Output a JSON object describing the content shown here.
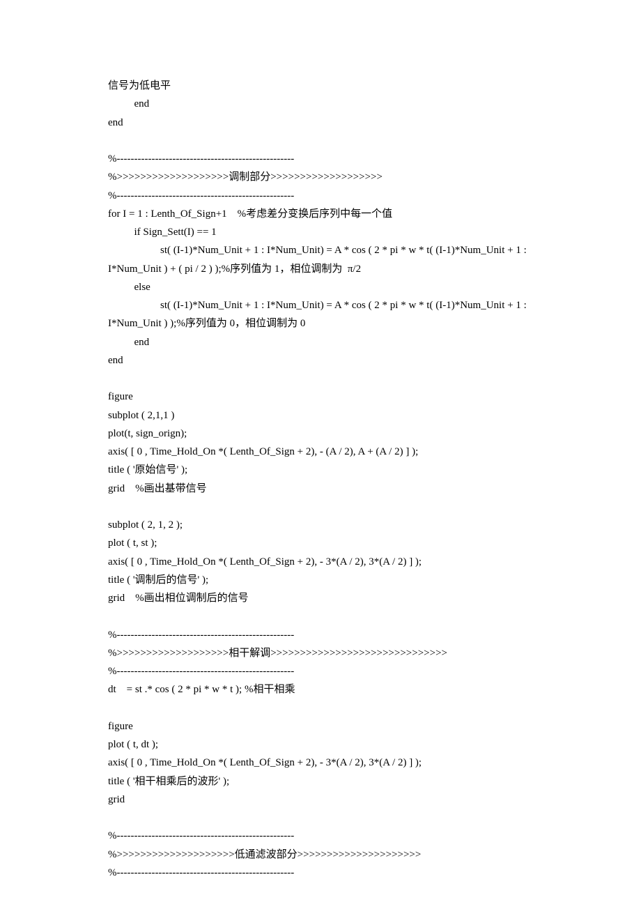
{
  "lines": [
    {
      "t": "信号为低电平",
      "indent": 0
    },
    {
      "t": "end",
      "indent": 1
    },
    {
      "t": "end",
      "indent": 0
    },
    {
      "t": "",
      "indent": 0,
      "blank": true
    },
    {
      "t": "%---------------------------------------------------",
      "indent": 0
    },
    {
      "t": "%>>>>>>>>>>>>>>>>>>>调制部分>>>>>>>>>>>>>>>>>>>",
      "indent": 0
    },
    {
      "t": "%---------------------------------------------------",
      "indent": 0
    },
    {
      "t": "for I = 1 : Lenth_Of_Sign+1    %考虑差分变换后序列中每一个值",
      "indent": 0
    },
    {
      "t": "if Sign_Sett(I) == 1",
      "indent": 1
    },
    {
      "t": "st( (I-1)*Num_Unit + 1 : I*Num_Unit) = A * cos ( 2 * pi * w * t( (I-1)*Num_Unit + 1 :",
      "indent": 2
    },
    {
      "t": "I*Num_Unit ) + ( pi / 2 ) );%序列值为 1，相位调制为  π/2",
      "indent": 0
    },
    {
      "t": "else",
      "indent": 1
    },
    {
      "t": "st( (I-1)*Num_Unit + 1 : I*Num_Unit) = A * cos ( 2 * pi * w * t( (I-1)*Num_Unit + 1 :",
      "indent": 2
    },
    {
      "t": "I*Num_Unit ) );%序列值为 0，相位调制为 0",
      "indent": 0
    },
    {
      "t": "end",
      "indent": 1
    },
    {
      "t": "end",
      "indent": 0
    },
    {
      "t": "",
      "indent": 0,
      "blank": true
    },
    {
      "t": "figure",
      "indent": 0
    },
    {
      "t": "subplot ( 2,1,1 )",
      "indent": 0
    },
    {
      "t": "plot(t, sign_orign);",
      "indent": 0
    },
    {
      "t": "axis( [ 0 , Time_Hold_On *( Lenth_Of_Sign + 2), - (A / 2), A + (A / 2) ] );",
      "indent": 0
    },
    {
      "t": "title ( '原始信号' );",
      "indent": 0
    },
    {
      "t": "grid    %画出基带信号",
      "indent": 0
    },
    {
      "t": "",
      "indent": 0,
      "blank": true
    },
    {
      "t": "subplot ( 2, 1, 2 );",
      "indent": 0
    },
    {
      "t": "plot ( t, st );",
      "indent": 0
    },
    {
      "t": "axis( [ 0 , Time_Hold_On *( Lenth_Of_Sign + 2), - 3*(A / 2), 3*(A / 2) ] );",
      "indent": 0
    },
    {
      "t": "title ( '调制后的信号' );",
      "indent": 0
    },
    {
      "t": "grid    %画出相位调制后的信号",
      "indent": 0
    },
    {
      "t": "",
      "indent": 0,
      "blank": true
    },
    {
      "t": "%---------------------------------------------------",
      "indent": 0
    },
    {
      "t": "%>>>>>>>>>>>>>>>>>>>相干解调>>>>>>>>>>>>>>>>>>>>>>>>>>>>>>",
      "indent": 0
    },
    {
      "t": "%---------------------------------------------------",
      "indent": 0
    },
    {
      "t": "dt    = st .* cos ( 2 * pi * w * t ); %相干相乘",
      "indent": 0
    },
    {
      "t": "",
      "indent": 0,
      "blank": true
    },
    {
      "t": "figure",
      "indent": 0
    },
    {
      "t": "plot ( t, dt );",
      "indent": 0
    },
    {
      "t": "axis( [ 0 , Time_Hold_On *( Lenth_Of_Sign + 2), - 3*(A / 2), 3*(A / 2) ] );",
      "indent": 0
    },
    {
      "t": "title ( '相干相乘后的波形' );",
      "indent": 0
    },
    {
      "t": "grid",
      "indent": 0
    },
    {
      "t": "",
      "indent": 0,
      "blank": true
    },
    {
      "t": "%---------------------------------------------------",
      "indent": 0
    },
    {
      "t": "%>>>>>>>>>>>>>>>>>>>>低通滤波部分>>>>>>>>>>>>>>>>>>>>>",
      "indent": 0
    },
    {
      "t": "%---------------------------------------------------",
      "indent": 0
    }
  ]
}
